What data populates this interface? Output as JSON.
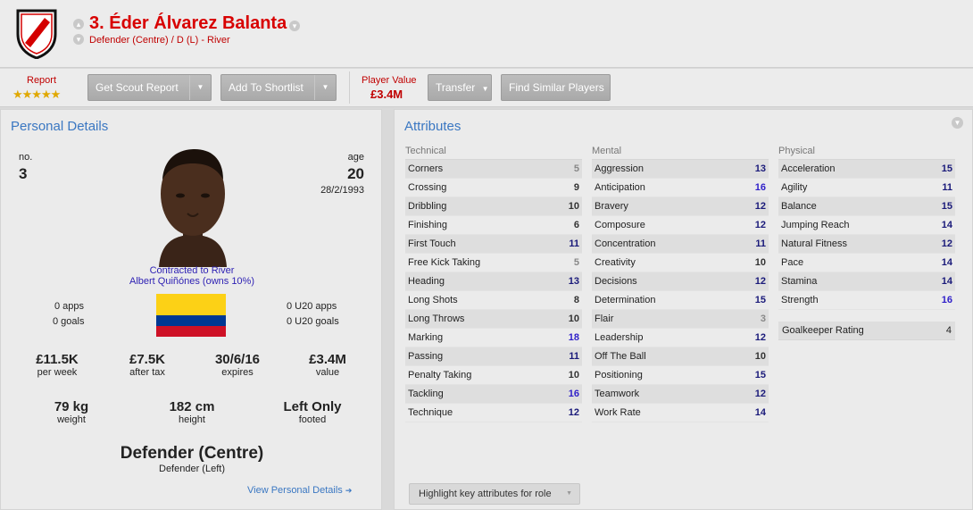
{
  "header": {
    "player_name": "3. Éder Álvarez Balanta",
    "subtitle": "Defender (Centre) / D (L) - River"
  },
  "toolbar": {
    "report_label": "Report",
    "report_stars": "★★★★★",
    "report_rating": 4.5,
    "scout_button": "Get Scout Report",
    "shortlist_button": "Add To Shortlist",
    "player_value_label": "Player Value",
    "player_value": "£3.4M",
    "transfer_button": "Transfer",
    "similar_button": "Find Similar Players"
  },
  "personal": {
    "title": "Personal Details",
    "no_label": "no.",
    "no_value": "3",
    "age_label": "age",
    "age_value": "20",
    "dob": "28/2/1993",
    "contract_line1": "Contracted to River",
    "contract_line2": "Albert Quiñónes (owns 10%)",
    "apps": "0 apps",
    "goals": "0 goals",
    "u20_apps": "0 U20 apps",
    "u20_goals": "0 U20 goals",
    "stats_row1": [
      {
        "value": "£11.5K",
        "label": "per week"
      },
      {
        "value": "£7.5K",
        "label": "after tax"
      },
      {
        "value": "30/6/16",
        "label": "expires"
      },
      {
        "value": "£3.4M",
        "label": "value"
      }
    ],
    "stats_row2": [
      {
        "value": "79 kg",
        "label": "weight"
      },
      {
        "value": "182 cm",
        "label": "height"
      },
      {
        "value": "Left Only",
        "label": "footed"
      }
    ],
    "position_main": "Defender (Centre)",
    "position_secondary": "Defender (Left)",
    "view_details_link": "View Personal Details"
  },
  "attributes": {
    "title": "Attributes",
    "technical": {
      "heading": "Technical",
      "items": [
        {
          "name": "Corners",
          "value": "5"
        },
        {
          "name": "Crossing",
          "value": "9"
        },
        {
          "name": "Dribbling",
          "value": "10"
        },
        {
          "name": "Finishing",
          "value": "6"
        },
        {
          "name": "First Touch",
          "value": "11"
        },
        {
          "name": "Free Kick Taking",
          "value": "5"
        },
        {
          "name": "Heading",
          "value": "13"
        },
        {
          "name": "Long Shots",
          "value": "8"
        },
        {
          "name": "Long Throws",
          "value": "10"
        },
        {
          "name": "Marking",
          "value": "18"
        },
        {
          "name": "Passing",
          "value": "11"
        },
        {
          "name": "Penalty Taking",
          "value": "10"
        },
        {
          "name": "Tackling",
          "value": "16"
        },
        {
          "name": "Technique",
          "value": "12"
        }
      ]
    },
    "mental": {
      "heading": "Mental",
      "items": [
        {
          "name": "Aggression",
          "value": "13"
        },
        {
          "name": "Anticipation",
          "value": "16"
        },
        {
          "name": "Bravery",
          "value": "12"
        },
        {
          "name": "Composure",
          "value": "12"
        },
        {
          "name": "Concentration",
          "value": "11"
        },
        {
          "name": "Creativity",
          "value": "10"
        },
        {
          "name": "Decisions",
          "value": "12"
        },
        {
          "name": "Determination",
          "value": "15"
        },
        {
          "name": "Flair",
          "value": "3"
        },
        {
          "name": "Leadership",
          "value": "12"
        },
        {
          "name": "Off The Ball",
          "value": "10"
        },
        {
          "name": "Positioning",
          "value": "15"
        },
        {
          "name": "Teamwork",
          "value": "12"
        },
        {
          "name": "Work Rate",
          "value": "14"
        }
      ]
    },
    "physical": {
      "heading": "Physical",
      "items": [
        {
          "name": "Acceleration",
          "value": "15"
        },
        {
          "name": "Agility",
          "value": "11"
        },
        {
          "name": "Balance",
          "value": "15"
        },
        {
          "name": "Jumping Reach",
          "value": "14"
        },
        {
          "name": "Natural Fitness",
          "value": "12"
        },
        {
          "name": "Pace",
          "value": "14"
        },
        {
          "name": "Stamina",
          "value": "14"
        },
        {
          "name": "Strength",
          "value": "16"
        }
      ]
    },
    "goalkeeper_label": "Goalkeeper Rating",
    "goalkeeper_value": "4",
    "highlight_button": "Highlight key attributes for role"
  },
  "colors": {
    "accent_red": "#d80000",
    "link_blue": "#3a77c2",
    "contract_purple": "#2c1fb3"
  }
}
